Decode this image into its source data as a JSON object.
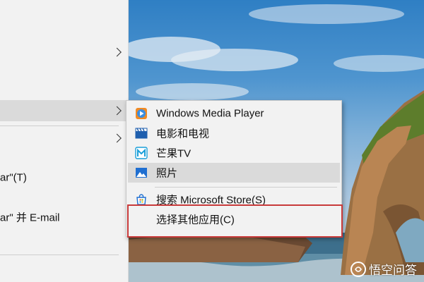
{
  "main_menu": {
    "items": [
      {
        "label": "",
        "has_submenu": true
      },
      {
        "label": "",
        "has_submenu": true,
        "highlighted": true
      },
      {
        "label": "",
        "has_submenu": true
      },
      {
        "label": "ar\"(T)"
      },
      {
        "label": "ar\" 并 E-mail"
      }
    ]
  },
  "submenu": {
    "items": [
      {
        "label": "Windows Media Player",
        "icon": "windows-media-player-icon"
      },
      {
        "label": "电影和电视",
        "icon": "movies-tv-icon"
      },
      {
        "label": "芒果TV",
        "icon": "mango-tv-icon"
      },
      {
        "label": "照片",
        "icon": "photos-icon",
        "highlighted": true
      },
      {
        "label": "搜索 Microsoft Store(S)",
        "icon": "store-icon"
      },
      {
        "label": "选择其他应用(C)",
        "outlined": true
      }
    ]
  },
  "watermark": {
    "text": "悟空问答"
  },
  "colors": {
    "menu_bg": "#f2f2f2",
    "hover_bg": "#dadada",
    "highlight_outline": "#c83a3a"
  }
}
